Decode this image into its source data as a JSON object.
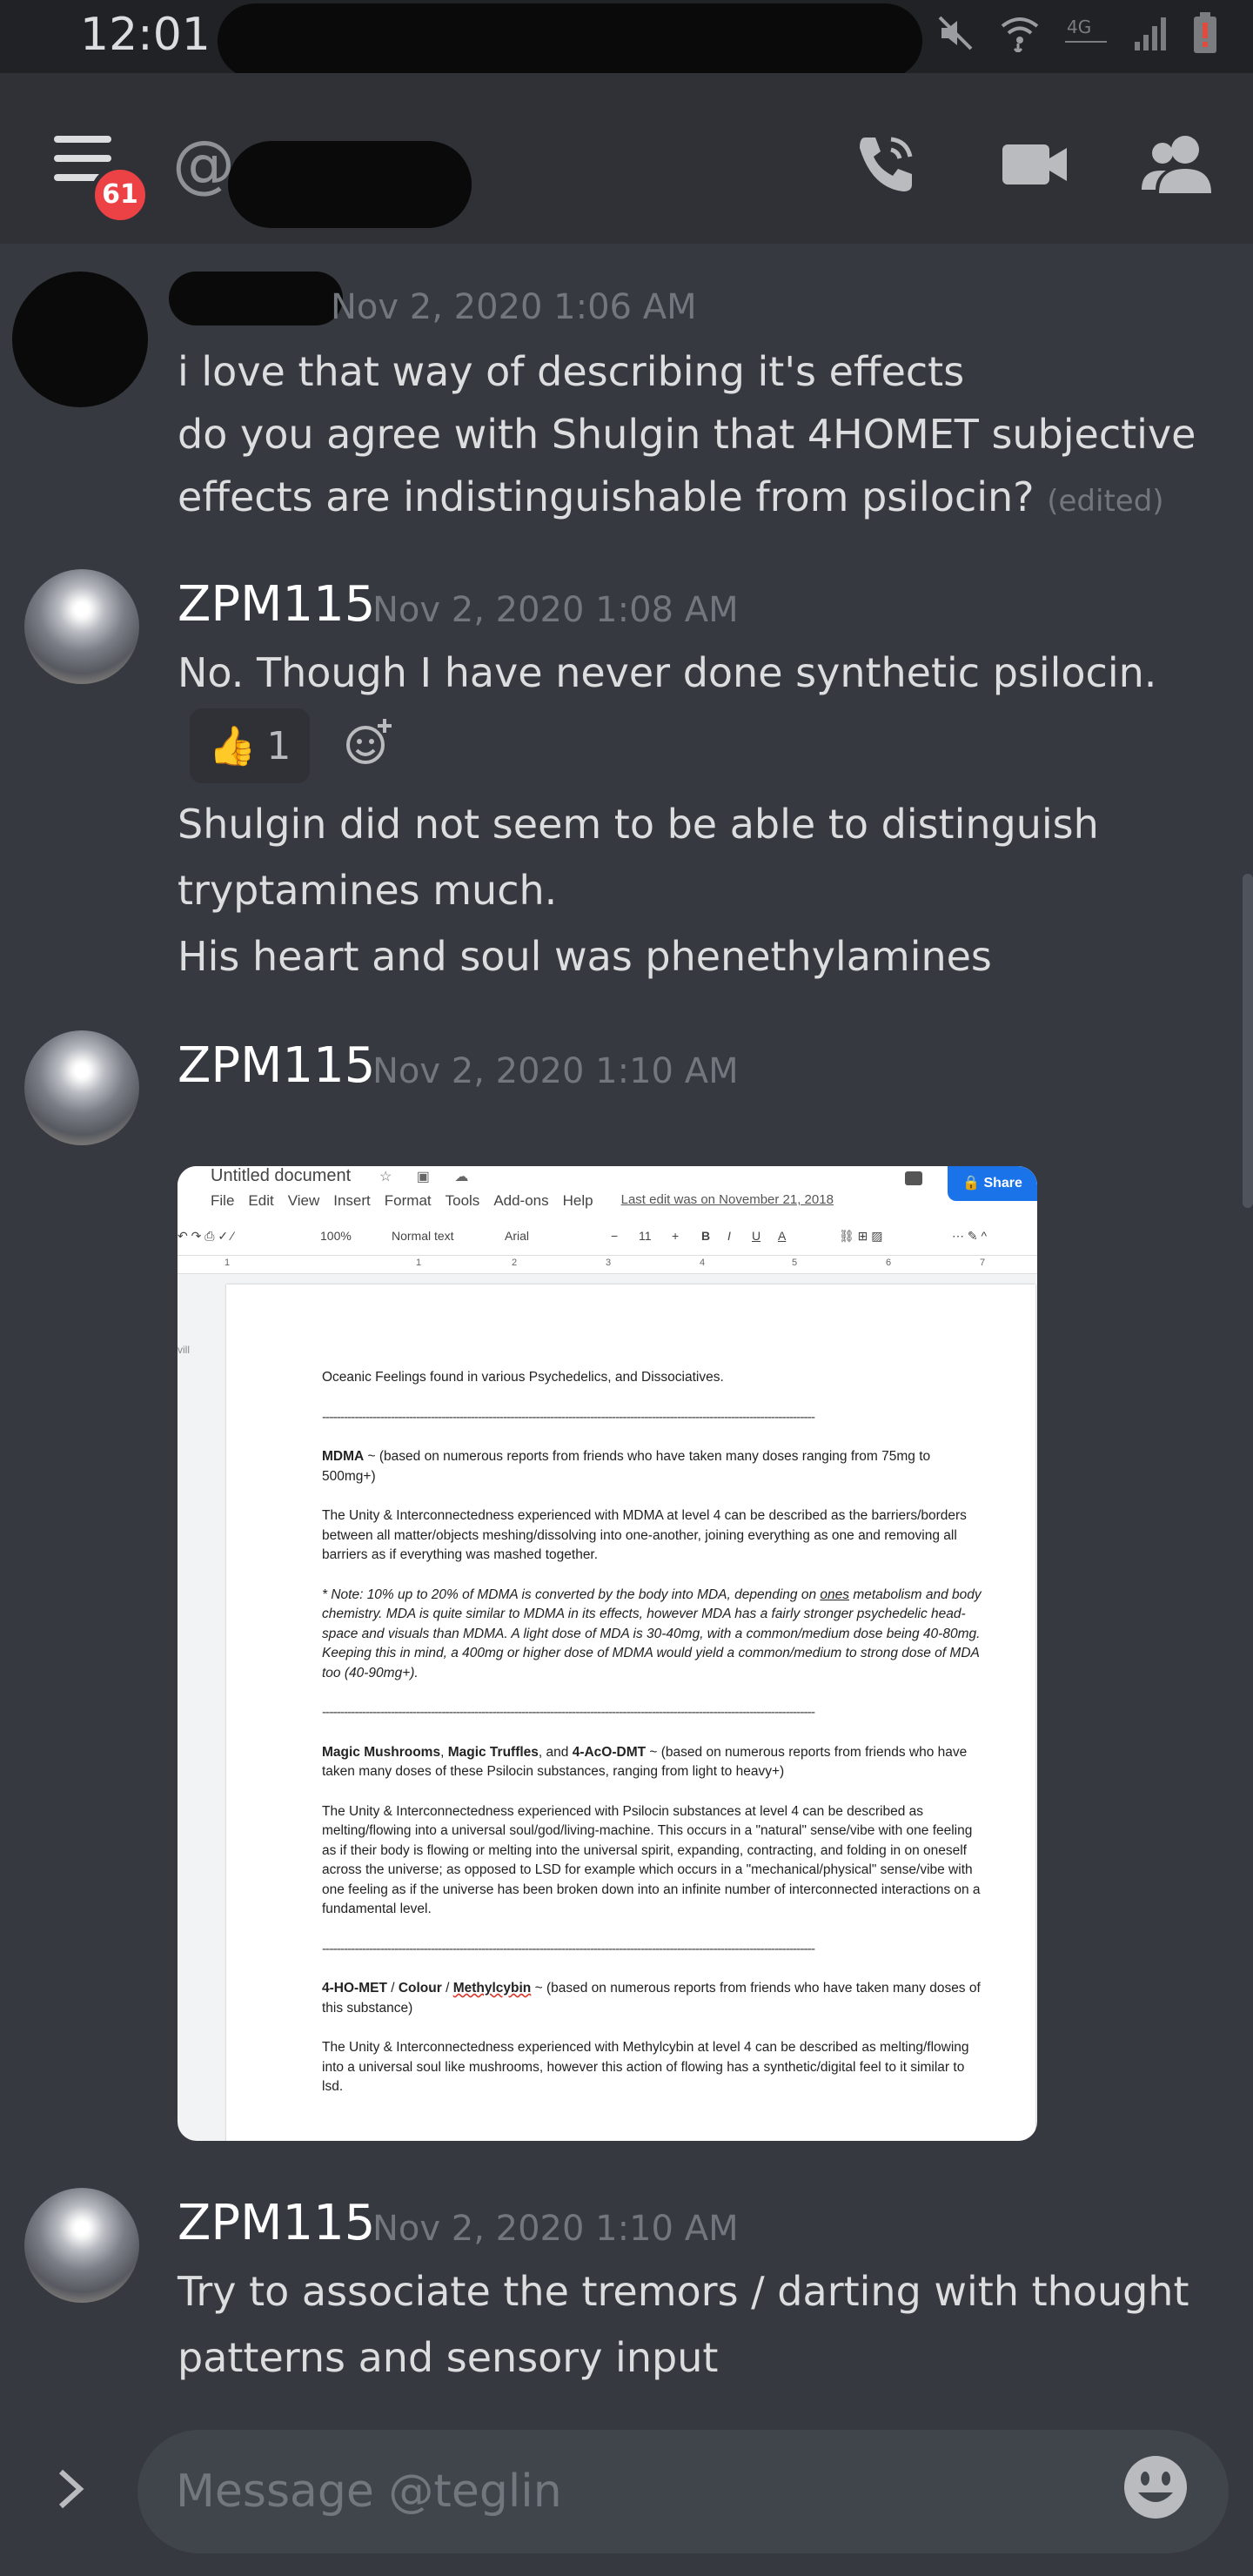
{
  "status_bar": {
    "time": "12:01"
  },
  "header": {
    "badge_count": "61"
  },
  "messages": [
    {
      "timestamp": "Nov 2, 2020 1:06 AM",
      "lines": [
        "i love that way of describing it's effects",
        "do you agree with Shulgin that 4HOMET subjective",
        "effects are indistinguishable from psilocin?"
      ],
      "edited_label": "(edited)"
    },
    {
      "author": "ZPM115",
      "timestamp": "Nov 2, 2020 1:08 AM",
      "lines": [
        "No. Though I have never done synthetic psilocin."
      ],
      "reaction": {
        "emoji": "👍",
        "count": "1"
      },
      "lines_after": [
        "Shulgin did not seem to be able to distinguish",
        "tryptamines much.",
        "His heart and soul was phenethylamines"
      ]
    },
    {
      "author": "ZPM115",
      "timestamp": "Nov 2, 2020 1:10 AM",
      "attachment": {
        "doc_title": "Untitled document",
        "menu": [
          "File",
          "Edit",
          "View",
          "Insert",
          "Format",
          "Tools",
          "Add-ons",
          "Help"
        ],
        "last_edit": "Last edit was on November 21, 2018",
        "share": "Share",
        "toolbar": {
          "zoom": "100%",
          "style": "Normal text",
          "font": "Arial",
          "size": "11"
        },
        "side_text": "vill",
        "body": {
          "heading": "Oceanic Feelings found in various Psychedelics, and Dissociatives.",
          "separator": "----------------------------------------------------------------------------------------------------------------------------------------",
          "mdma_title": "MDMA",
          "mdma_sub": " ~ (based on numerous reports from friends who have taken many doses ranging from 75mg to 500mg+)",
          "mdma_text": "The Unity & Interconnectedness experienced with MDMA at level 4 can be described as the barriers/borders between all matter/objects meshing/dissolving into one-another, joining everything as one and removing all barriers as if everything was mashed together.",
          "note_a": "* Note: 10% up to 20% of MDMA is converted by the body into MDA, depending on ",
          "note_ones": "ones",
          "note_b": " metabolism and body chemistry. MDA is quite similar to MDMA in its effects, however MDA has a fairly stronger psychedelic head-space and visuals than MDMA. A light dose of MDA is 30-40mg, with a common/medium dose being 40-80mg. Keeping this in mind, a 400mg or higher dose of MDMA would yield a common/medium to strong dose of MDA too (40-90mg+).",
          "mush_a": "Magic Mushrooms",
          "mush_b": "Magic Truffles",
          "mush_and": ", and ",
          "mush_c": "4-AcO-DMT",
          "mush_comma": ", ",
          "mush_sub": " ~ (based on numerous reports from friends who have taken many doses of these Psilocin substances, ranging from light to heavy+)",
          "mush_text": "The Unity & Interconnectedness experienced with Psilocin substances at level 4 can be described as melting/flowing into a universal soul/god/living-machine. This occurs in a \"natural\" sense/vibe with one feeling as if their body is flowing or melting into the universal spirit, expanding, contracting, and folding in on oneself across the universe; as opposed to LSD for example which occurs in a \"mechanical/physical\" sense/vibe with one feeling as if the universe has been broken down into an infinite number of interconnected interactions on a fundamental level.",
          "meth_a": "4-HO-MET",
          "meth_b": "Colour",
          "meth_c": "Methylcybin",
          "meth_slash": " / ",
          "meth_sub": " ~ (based on numerous reports from friends who have taken many doses of this substance)",
          "meth_text": "The Unity & Interconnectedness experienced with Methylcybin at level 4 can be described as melting/flowing into a universal soul like mushrooms, however this action of flowing has a synthetic/digital feel to it similar to lsd."
        }
      }
    },
    {
      "author": "ZPM115",
      "timestamp": "Nov 2, 2020 1:10 AM",
      "lines": [
        "Try to associate the tremors / darting with thought",
        "patterns and sensory input"
      ]
    }
  ],
  "composer": {
    "placeholder": "Message @teglin"
  },
  "colors": {
    "background": "#36393f",
    "header": "#2f3136",
    "badge": "#ed4245",
    "accent": "#1a73e8"
  }
}
